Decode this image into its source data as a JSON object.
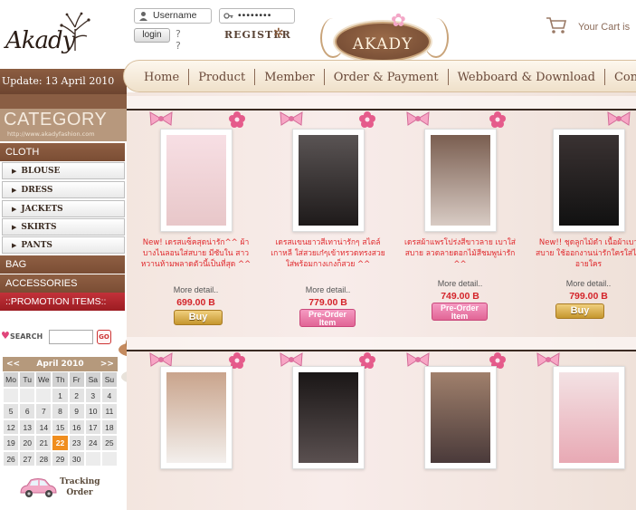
{
  "header": {
    "logo_text": "Akady",
    "username_placeholder": "Username",
    "password_mask": "••••••••",
    "login_label": "login",
    "register_label": "REGISTER",
    "brand_badge": "AKADY",
    "cart_label": "Your Cart is"
  },
  "nav": {
    "update": "Update: 13 April 2010",
    "items": [
      "Home",
      "Product",
      "Member",
      "Order & Payment",
      "Webboard & Download",
      "Contact"
    ]
  },
  "sidebar": {
    "category_title": "CATEGORY",
    "category_url": "http://www.akadyfashion.com",
    "cloth": "CLOTH",
    "sub_items": [
      "BLOUSE",
      "DRESS",
      "JACKETS",
      "SKIRTS",
      "PANTS"
    ],
    "bag": "BAG",
    "accessories": "ACCESSORIES",
    "promotion": "::PROMOTION ITEMS::",
    "search_label": "SEARCH",
    "search_go": "GO",
    "tracking_line1": "Tracking",
    "tracking_line2": "Order"
  },
  "calendar": {
    "prev_label": "<<",
    "month": "April 2010",
    "next_label": ">>",
    "days": [
      "Mo",
      "Tu",
      "We",
      "Th",
      "Fr",
      "Sa",
      "Su"
    ],
    "weeks": [
      [
        "",
        "",
        "",
        "1",
        "2",
        "3",
        "4"
      ],
      [
        "5",
        "6",
        "7",
        "8",
        "9",
        "10",
        "11"
      ],
      [
        "12",
        "13",
        "14",
        "15",
        "16",
        "17",
        "18"
      ],
      [
        "19",
        "20",
        "21",
        "22",
        "23",
        "24",
        "25"
      ],
      [
        "26",
        "27",
        "28",
        "29",
        "30",
        "",
        ""
      ]
    ],
    "today": "22"
  },
  "products": [
    {
      "desc": "New! เดรสแซ็คสุดน่ารัก^^ ผ้าบางไนลอนใส่สบาย มีซับใน สาวหวานห้ามพลาดตัวนี้เป็นที่สุด ^^",
      "more": "More detail..",
      "price": "699.00 B",
      "button": "Buy",
      "button_type": "buy",
      "photo_color": "#f4d6d8"
    },
    {
      "desc": "เดรสแขนยาวสีเทาน่ารักๆ สไตล์เกาหลี ใส่สวยเก๋ๆเข้าทรวดทรงสวย ใส่พร้อมกางเกงก็สวย ^^",
      "more": "More detail..",
      "price": "779.00 B",
      "button": "Pre-Order Item",
      "button_type": "preorder",
      "photo_color": "#2e2a2a"
    },
    {
      "desc": "เดรสผ้าแพรโปร่งสีขาวลาย เบาใส่สบาย ลวดลายดอกไม้สีชมพูน่ารัก ^^",
      "more": "More detail..",
      "price": "749.00 B",
      "button": "Pre-Order Item",
      "button_type": "preorder",
      "photo_color": "#c9b8ae"
    },
    {
      "desc": "New!! ชุดลูกไม้ดำ เนื้อผ้าเบาสบาย ใช้ออกงานน่ารักใครใส่ไม่อายใคร",
      "more": "More detail..",
      "price": "799.00 B",
      "button": "Buy",
      "button_type": "buy",
      "photo_color": "#1e1a1a"
    }
  ],
  "colors": {
    "accent_brown": "#7a4d34",
    "price_red": "#d4242a",
    "today_orange": "#f08e1f"
  }
}
